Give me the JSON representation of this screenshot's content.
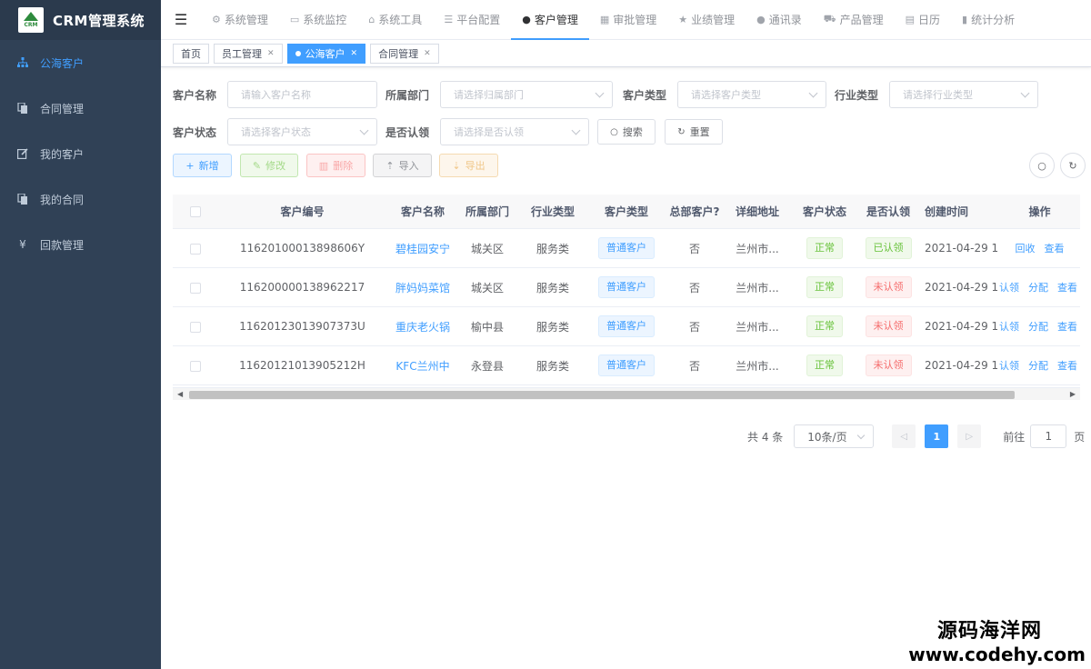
{
  "app": {
    "title": "CRM管理系统",
    "logo_text": "CRM"
  },
  "sidebar": {
    "items": [
      {
        "label": "公海客户",
        "icon": "org-chart-icon",
        "active": true
      },
      {
        "label": "合同管理",
        "icon": "copy-icon"
      },
      {
        "label": "我的客户",
        "icon": "edit-icon"
      },
      {
        "label": "我的合同",
        "icon": "copy-icon"
      },
      {
        "label": "回款管理",
        "icon": "yen-icon"
      }
    ]
  },
  "topnav": {
    "items": [
      {
        "label": "系统管理",
        "icon": "gear-icon"
      },
      {
        "label": "系统监控",
        "icon": "monitor-icon"
      },
      {
        "label": "系统工具",
        "icon": "toolbox-icon"
      },
      {
        "label": "平台配置",
        "icon": "list-icon"
      },
      {
        "label": "客户管理",
        "icon": "user-icon",
        "active": true
      },
      {
        "label": "审批管理",
        "icon": "table-icon"
      },
      {
        "label": "业绩管理",
        "icon": "star-icon"
      },
      {
        "label": "通讯录",
        "icon": "contact-icon"
      },
      {
        "label": "产品管理",
        "icon": "cart-icon"
      },
      {
        "label": "日历",
        "icon": "calendar-icon"
      },
      {
        "label": "统计分析",
        "icon": "bar-chart-icon"
      }
    ]
  },
  "tags": [
    {
      "label": "首页"
    },
    {
      "label": "员工管理"
    },
    {
      "label": "公海客户",
      "active": true
    },
    {
      "label": "合同管理"
    }
  ],
  "search": {
    "customer_name": {
      "label": "客户名称",
      "placeholder": "请输入客户名称"
    },
    "department": {
      "label": "所属部门",
      "placeholder": "请选择归属部门"
    },
    "customer_type": {
      "label": "客户类型",
      "placeholder": "请选择客户类型"
    },
    "industry": {
      "label": "行业类型",
      "placeholder": "请选择行业类型"
    },
    "status": {
      "label": "客户状态",
      "placeholder": "请选择客户状态"
    },
    "recognized": {
      "label": "是否认领",
      "placeholder": "请选择是否认领"
    },
    "search_btn": "搜索",
    "reset_btn": "重置"
  },
  "toolbar": {
    "add": "新增",
    "edit": "修改",
    "delete": "删除",
    "import": "导入",
    "export": "导出"
  },
  "table": {
    "headers": {
      "code": "客户编号",
      "name": "客户名称",
      "dept": "所属部门",
      "industry": "行业类型",
      "type": "客户类型",
      "hq": "总部客户?",
      "address": "详细地址",
      "status": "客户状态",
      "recognized": "是否认领",
      "created": "创建时间",
      "ops": "操作"
    },
    "rows": [
      {
        "code": "11620100013898606Y",
        "name": "碧桂园安宁",
        "dept": "城关区",
        "industry": "服务类",
        "type": "普通客户",
        "hq": "否",
        "address": "兰州市...",
        "status": "正常",
        "recognized": "已认领",
        "recognized_yes": true,
        "created": "2021-04-29 1",
        "ops": [
          "回收",
          "查看"
        ]
      },
      {
        "code": "116200000138962217",
        "name": "胖妈妈菜馆",
        "dept": "城关区",
        "industry": "服务类",
        "type": "普通客户",
        "hq": "否",
        "address": "兰州市...",
        "status": "正常",
        "recognized": "未认领",
        "recognized_yes": false,
        "created": "2021-04-29 1",
        "ops": [
          "认领",
          "分配",
          "查看"
        ]
      },
      {
        "code": "11620123013907373U",
        "name": "重庆老火锅",
        "dept": "榆中县",
        "industry": "服务类",
        "type": "普通客户",
        "hq": "否",
        "address": "兰州市...",
        "status": "正常",
        "recognized": "未认领",
        "recognized_yes": false,
        "created": "2021-04-29 1",
        "ops": [
          "认领",
          "分配",
          "查看"
        ]
      },
      {
        "code": "11620121013905212H",
        "name": "KFC兰州中",
        "dept": "永登县",
        "industry": "服务类",
        "type": "普通客户",
        "hq": "否",
        "address": "兰州市...",
        "status": "正常",
        "recognized": "未认领",
        "recognized_yes": false,
        "created": "2021-04-29 1",
        "ops": [
          "认领",
          "分配",
          "查看"
        ]
      }
    ]
  },
  "pagination": {
    "total": "共 4 条",
    "page_size": "10条/页",
    "current": "1",
    "goto_label": "前往",
    "goto_value": "1",
    "page_suffix": "页"
  },
  "watermark": {
    "line1": "源码海洋网",
    "line2": "www.codehy.com"
  },
  "colors": {
    "primary": "#409eff",
    "sidebar_bg": "#304156",
    "success": "#67c23a",
    "danger": "#f56c6c"
  }
}
